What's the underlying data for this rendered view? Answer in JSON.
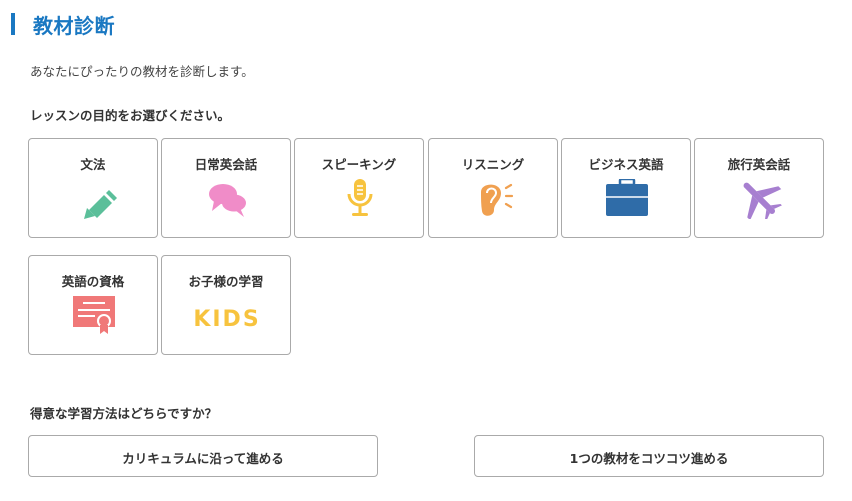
{
  "header": {
    "title": "教材診断"
  },
  "intro": "あなたにぴったりの教材を診断します。",
  "question_purpose": "レッスンの目的をお選びください。",
  "purposes": [
    {
      "label": "文法",
      "icon": "pencil-icon",
      "color": "#5bbf9a"
    },
    {
      "label": "日常英会話",
      "icon": "speech-bubbles-icon",
      "color": "#f08cc8"
    },
    {
      "label": "スピーキング",
      "icon": "microphone-icon",
      "color": "#f7c33e"
    },
    {
      "label": "リスニング",
      "icon": "ear-icon",
      "color": "#f0a050"
    },
    {
      "label": "ビジネス英語",
      "icon": "briefcase-icon",
      "color": "#2f6ca8"
    },
    {
      "label": "旅行英会話",
      "icon": "airplane-icon",
      "color": "#a77fd0"
    },
    {
      "label": "英語の資格",
      "icon": "certificate-icon",
      "color": "#f07878"
    },
    {
      "label": "お子様の学習",
      "icon": "kids-icon",
      "color": "#f7c33e",
      "icon_text": "KIDS"
    }
  ],
  "question_method": "得意な学習方法はどちらですか？",
  "methods": [
    {
      "label": "カリキュラムに沿って進める"
    },
    {
      "label": "1つの教材をコツコツ進める"
    }
  ]
}
